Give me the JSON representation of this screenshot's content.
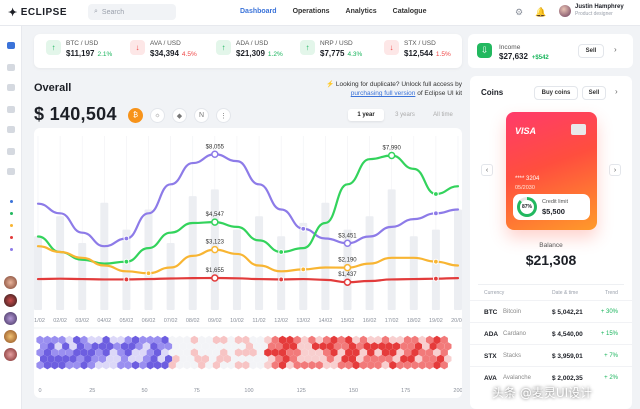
{
  "brand": {
    "name": "ECLIPSE"
  },
  "search": {
    "placeholder": "Search"
  },
  "nav": [
    "Dashboard",
    "Operations",
    "Analytics",
    "Catalogue"
  ],
  "user": {
    "name": "Justin Hamphrey",
    "role": "Product designer"
  },
  "colors": {
    "accent": "#3b73d9",
    "up": "#18b45b",
    "down": "#ef4646",
    "purple": "#8d7be8",
    "green": "#33d35c",
    "orange": "#f8b533",
    "red": "#e23b3b"
  },
  "tickers": [
    {
      "pair": "BTC / USD",
      "value": "$11,197",
      "change": "2.1%",
      "dir": "up"
    },
    {
      "pair": "AVA / USD",
      "value": "$34,394",
      "change": "4.5%",
      "dir": "down"
    },
    {
      "pair": "ADA / USD",
      "value": "$21,309",
      "change": "1.2%",
      "dir": "up"
    },
    {
      "pair": "NRP / USD",
      "value": "$7,775",
      "change": "4.3%",
      "dir": "up"
    },
    {
      "pair": "STX / USD",
      "value": "$12,544",
      "change": "1.5%",
      "dir": "down"
    }
  ],
  "income": {
    "label": "Income",
    "value": "$27,632",
    "change": "+$542",
    "button": "Sell"
  },
  "overall": {
    "title": "Overall",
    "value": "$ 140,504",
    "coins": [
      "bitcoin-icon",
      "sun-coin-icon",
      "ethereum-icon",
      "neo-coin-icon",
      "more-icon"
    ]
  },
  "promo": {
    "text": "Looking for duplicate? Unlock full access by",
    "link": "purchasing full version",
    "suffix": "of Eclipse UI kit"
  },
  "ranges": [
    "1 year",
    "3 years",
    "All time"
  ],
  "chart_data": {
    "type": "line",
    "x": [
      "01/02",
      "02/02",
      "03/02",
      "04/02",
      "05/02",
      "06/02",
      "07/02",
      "08/02",
      "09/02",
      "10/02",
      "11/02",
      "12/02",
      "13/02",
      "14/02",
      "15/02",
      "16/02",
      "17/02",
      "18/02",
      "19/02",
      "20/02"
    ],
    "series": [
      {
        "values": [
          5500,
          5000,
          4000,
          3300,
          3700,
          5000,
          6500,
          7600,
          8055,
          7700,
          6500,
          5200,
          4200,
          3700,
          3451,
          3800,
          4300,
          4700,
          5000,
          5200
        ]
      },
      {
        "values": [
          3800,
          3000,
          2600,
          2400,
          2500,
          3200,
          4000,
          4500,
          4547,
          4300,
          3600,
          3000,
          3200,
          4500,
          6500,
          7800,
          7990,
          7300,
          6000,
          6400
        ]
      },
      {
        "values": [
          3300,
          3000,
          2700,
          2300,
          2000,
          1900,
          2200,
          2800,
          3123,
          2900,
          2300,
          2000,
          2100,
          2200,
          2190,
          2400,
          2700,
          2700,
          2500,
          2300
        ]
      },
      {
        "values": [
          1600,
          1620,
          1600,
          1580,
          1580,
          1600,
          1630,
          1650,
          1655,
          1640,
          1600,
          1580,
          1600,
          1560,
          1437,
          1500,
          1580,
          1600,
          1620,
          1650
        ]
      }
    ],
    "annotations": [
      "$8,055",
      "$4,547",
      "$3,123",
      "$1,655",
      "$7,990",
      "$3,451",
      "$2,190",
      "$1,437"
    ],
    "heat_x": [
      "0",
      "25",
      "50",
      "75",
      "100",
      "125",
      "150",
      "175",
      "200"
    ],
    "ylim": [
      0,
      9000
    ]
  },
  "coins": {
    "title": "Coins",
    "buy": "Buy coins",
    "sell": "Sell",
    "card": {
      "brand": "VISA",
      "number": "**** 3204",
      "expiry": "05/2030",
      "limit_pct": "87%",
      "limit_label": "Credit limit",
      "limit_value": "$5,500"
    },
    "balance_label": "Balance",
    "balance": "$21,308",
    "headers": [
      "Currency",
      "Date & time",
      "Trend"
    ],
    "rows": [
      {
        "sym": "BTC",
        "name": "Bitcoin",
        "amount": "$ 5,042,21",
        "trend": "+ 30%"
      },
      {
        "sym": "ADA",
        "name": "Cardano",
        "amount": "$ 4,540,00",
        "trend": "+ 15%"
      },
      {
        "sym": "STX",
        "name": "Stacks",
        "amount": "$ 3,959,01",
        "trend": "+ 7%"
      },
      {
        "sym": "AVA",
        "name": "Avalanche",
        "amount": "$ 2,002,35",
        "trend": "+ 2%"
      }
    ]
  },
  "watermark": "头条 @麦灵UI设计"
}
